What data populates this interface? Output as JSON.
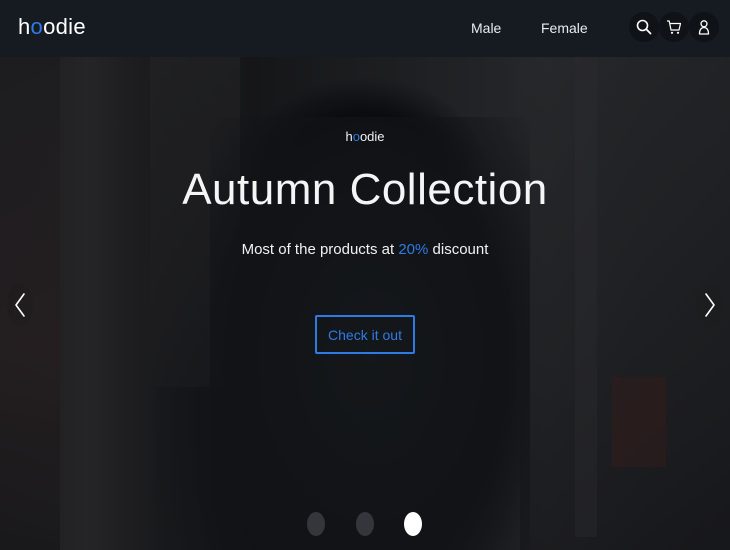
{
  "navbar": {
    "brand": {
      "before": "h",
      "accent": "o",
      "after": "odie"
    },
    "links": [
      {
        "label": "Male"
      },
      {
        "label": "Female"
      }
    ],
    "icons": [
      "search-icon",
      "cart-icon",
      "user-icon"
    ]
  },
  "hero": {
    "brand": {
      "before": "h",
      "accent": "o",
      "after": "odie"
    },
    "title": "Autumn Collection",
    "subtitle": {
      "before": "Most of the products at ",
      "highlight": "20%",
      "after": " discount"
    },
    "cta_label": "Check it out",
    "active_slide": 3,
    "slide_count": 3
  },
  "colors": {
    "accent": "#2f7be6",
    "navbar_bg": "#161a21",
    "text": "#ffffff"
  }
}
